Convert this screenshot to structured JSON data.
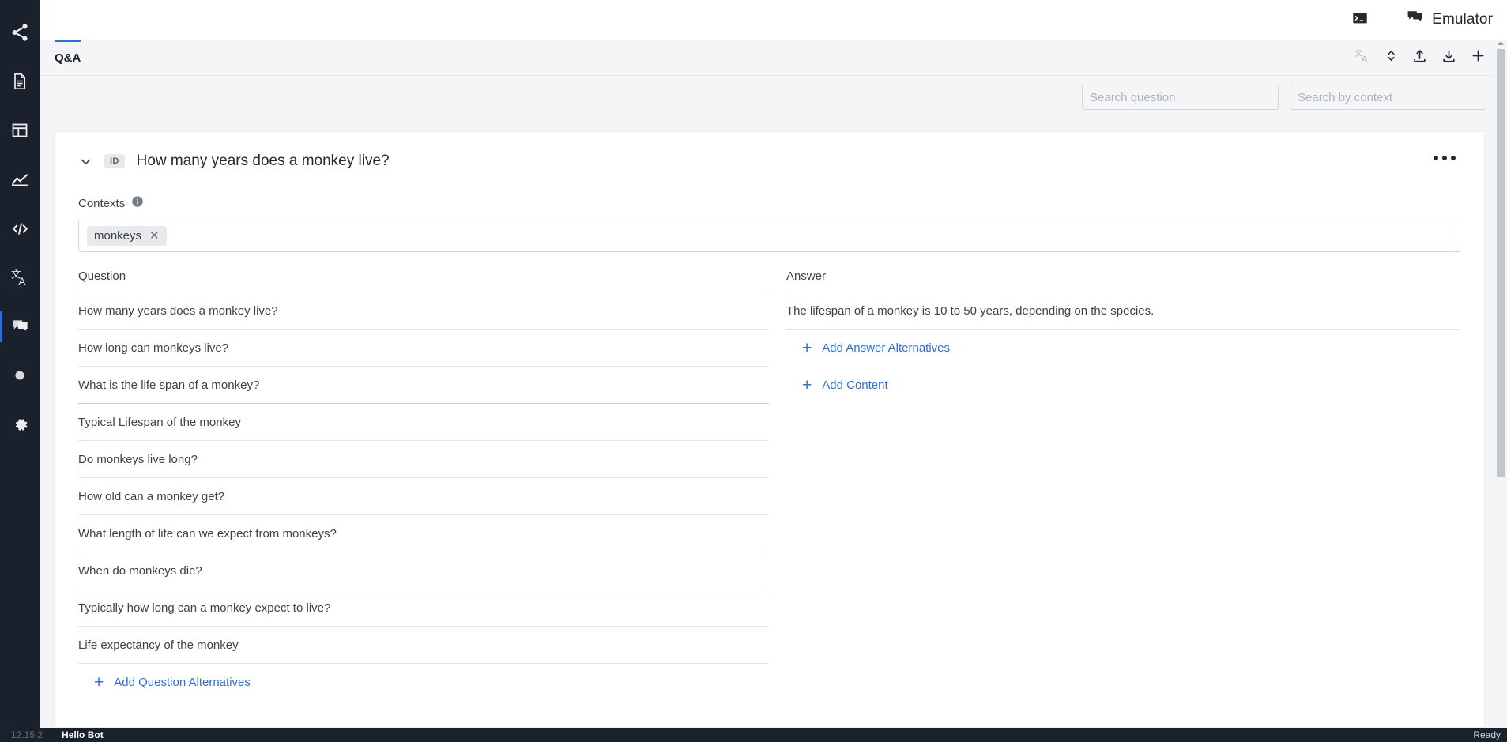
{
  "rail": {
    "items": [
      {
        "name": "share-icon",
        "title": "Flow"
      },
      {
        "name": "document-icon",
        "title": "Content"
      },
      {
        "name": "layout-icon",
        "title": "Layout"
      },
      {
        "name": "analytics-icon",
        "title": "Analytics"
      },
      {
        "name": "code-icon",
        "title": "Code"
      },
      {
        "name": "translate-icon",
        "title": "Translate"
      },
      {
        "name": "chat-icon",
        "title": "Q&A"
      },
      {
        "name": "circle-icon",
        "title": "Record"
      },
      {
        "name": "gear-icon",
        "title": "Settings"
      }
    ],
    "active_index": 6
  },
  "topbar": {
    "terminal_icon": "terminal-icon",
    "emulator_icon": "chat-icon",
    "emulator_label": "Emulator"
  },
  "tabstrip": {
    "tabs": [
      {
        "label": "Q&A",
        "active": true
      }
    ],
    "actions": [
      {
        "name": "translate-icon",
        "label": "Translate",
        "disabled": true
      },
      {
        "name": "sort-icon",
        "label": "Sort",
        "disabled": false
      },
      {
        "name": "upload-icon",
        "label": "Import",
        "disabled": false
      },
      {
        "name": "download-icon",
        "label": "Export",
        "disabled": false
      },
      {
        "name": "plus-icon",
        "label": "Add",
        "disabled": false
      }
    ]
  },
  "search": {
    "question_value": "",
    "question_placeholder": "Search question",
    "context_value": "",
    "context_placeholder": "Search by context"
  },
  "qa": {
    "id_badge": "ID",
    "title": "How many years does a monkey live?",
    "contexts_label": "Contexts",
    "contexts_info_icon": "info-icon",
    "context_chips": [
      {
        "label": "monkeys"
      }
    ],
    "question_column_header": "Question",
    "answer_column_header": "Answer",
    "questions": [
      "How many years does a monkey live?",
      "How long can monkeys live?",
      "What is the life span of a monkey?",
      "Typical Lifespan of the monkey",
      "Do monkeys live long?",
      "How old can a monkey get?",
      "What length of life can we expect from monkeys?",
      "When do monkeys die?",
      "Typically how long can a monkey expect to live?",
      "Life expectancy of the monkey"
    ],
    "answers": [
      "The lifespan of a monkey is 10 to 50 years, depending on the species."
    ],
    "add_question_alternatives": "Add Question Alternatives",
    "add_answer_alternatives": "Add Answer Alternatives",
    "add_content": "Add Content"
  },
  "statusbar": {
    "version": "12.15.2",
    "bot_name": "Hello Bot",
    "status": "Ready"
  },
  "colors": {
    "accent": "#2f6fd0",
    "rail_bg": "#1b212c",
    "panel_bg": "#f4f5f7",
    "text": "#3c4149"
  }
}
